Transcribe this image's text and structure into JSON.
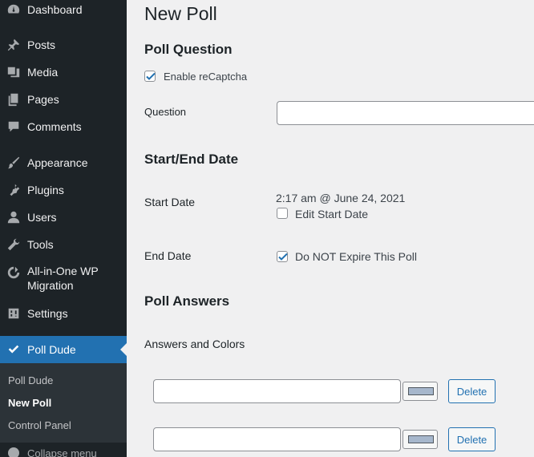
{
  "sidebar": {
    "items": [
      {
        "label": "Dashboard",
        "icon": "dashboard-icon"
      },
      {
        "label": "Posts",
        "icon": "pin-icon"
      },
      {
        "label": "Media",
        "icon": "media-icon"
      },
      {
        "label": "Pages",
        "icon": "pages-icon"
      },
      {
        "label": "Comments",
        "icon": "comment-icon"
      },
      {
        "label": "Appearance",
        "icon": "brush-icon"
      },
      {
        "label": "Plugins",
        "icon": "plugin-icon"
      },
      {
        "label": "Users",
        "icon": "user-icon"
      },
      {
        "label": "Tools",
        "icon": "wrench-icon"
      },
      {
        "label": "All-in-One WP",
        "label2": "Migration",
        "icon": "migration-icon"
      },
      {
        "label": "Settings",
        "icon": "settings-icon"
      },
      {
        "label": "Poll Dude",
        "icon": "check-icon"
      }
    ],
    "submenu": [
      {
        "label": "Poll Dude"
      },
      {
        "label": "New Poll"
      },
      {
        "label": "Control Panel"
      }
    ],
    "collapse_label": "Collapse menu"
  },
  "main": {
    "title": "New Poll",
    "poll_question": {
      "heading": "Poll Question",
      "recaptcha_label": "Enable reCaptcha",
      "recaptcha_checked": true,
      "question_label": "Question",
      "question_value": ""
    },
    "dates": {
      "heading": "Start/End Date",
      "start_label": "Start Date",
      "start_value": "2:17 am @ June 24, 2021",
      "edit_start_label": "Edit Start Date",
      "edit_start_checked": false,
      "end_label": "End Date",
      "no_expire_label": "Do NOT Expire This Poll",
      "no_expire_checked": true
    },
    "answers": {
      "heading": "Poll Answers",
      "label": "Answers and Colors",
      "rows": [
        {
          "value": "",
          "color": "#a6b7cc",
          "delete_label": "Delete"
        },
        {
          "value": "",
          "color": "#a6b7cc",
          "delete_label": "Delete"
        }
      ]
    }
  },
  "colors": {
    "sidebar_bg": "#1d2327",
    "submenu_bg": "#2c3338",
    "accent": "#2271b1",
    "page_bg": "#f0f0f1"
  }
}
